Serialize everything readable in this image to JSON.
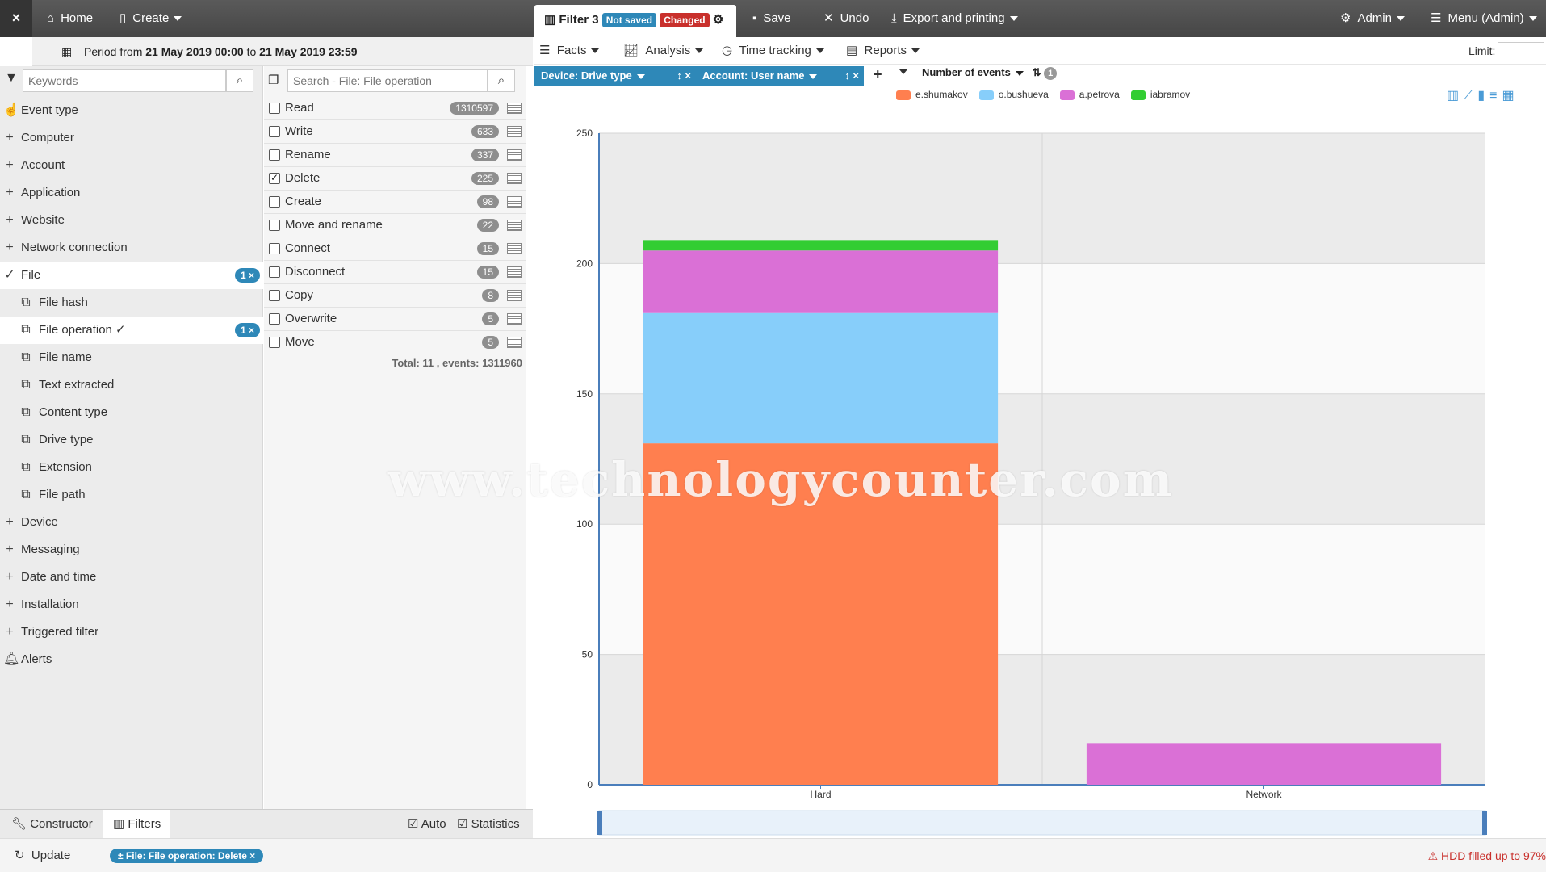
{
  "topbar": {
    "close_label": "×",
    "home": "Home",
    "create": "Create",
    "filter_title": "Filter 3",
    "not_saved": "Not saved",
    "changed": "Changed",
    "save": "Save",
    "undo": "Undo",
    "export": "Export and printing",
    "admin": "Admin",
    "menu": "Menu (Admin)"
  },
  "period": {
    "prefix": "Period from",
    "from": "21 May 2019 00:00",
    "to_word": "to",
    "to": "21 May 2019 23:59"
  },
  "sidebar": {
    "keywords_placeholder": "Keywords",
    "items": [
      {
        "label": "Event type",
        "kind": "icon",
        "icon": "hand-icon"
      },
      {
        "label": "Computer",
        "kind": "plus"
      },
      {
        "label": "Account",
        "kind": "plus"
      },
      {
        "label": "Application",
        "kind": "plus"
      },
      {
        "label": "Website",
        "kind": "plus"
      },
      {
        "label": "Network connection",
        "kind": "plus"
      },
      {
        "label": "File",
        "kind": "check",
        "count": "1 ×"
      },
      {
        "label": "File hash",
        "kind": "sub"
      },
      {
        "label": "File operation ✓",
        "kind": "sub",
        "count": "1 ×"
      },
      {
        "label": "File name",
        "kind": "sub"
      },
      {
        "label": "Text extracted",
        "kind": "sub"
      },
      {
        "label": "Content type",
        "kind": "sub"
      },
      {
        "label": "Drive type",
        "kind": "sub"
      },
      {
        "label": "Extension",
        "kind": "sub"
      },
      {
        "label": "File path",
        "kind": "sub"
      },
      {
        "label": "Device",
        "kind": "plus"
      },
      {
        "label": "Messaging",
        "kind": "plus"
      },
      {
        "label": "Date and time",
        "kind": "plus"
      },
      {
        "label": "Installation",
        "kind": "plus"
      },
      {
        "label": "Triggered filter",
        "kind": "plus"
      },
      {
        "label": "Alerts",
        "kind": "icon",
        "icon": "bell-icon"
      }
    ]
  },
  "values": {
    "search_placeholder": "Search - File: File operation",
    "rows": [
      {
        "label": "Read",
        "count": "1310597",
        "checked": false
      },
      {
        "label": "Write",
        "count": "633",
        "checked": false
      },
      {
        "label": "Rename",
        "count": "337",
        "checked": false
      },
      {
        "label": "Delete",
        "count": "225",
        "checked": true
      },
      {
        "label": "Create",
        "count": "98",
        "checked": false
      },
      {
        "label": "Move and rename",
        "count": "22",
        "checked": false
      },
      {
        "label": "Connect",
        "count": "15",
        "checked": false
      },
      {
        "label": "Disconnect",
        "count": "15",
        "checked": false
      },
      {
        "label": "Copy",
        "count": "8",
        "checked": false
      },
      {
        "label": "Overwrite",
        "count": "5",
        "checked": false
      },
      {
        "label": "Move",
        "count": "5",
        "checked": false
      }
    ],
    "total": "Total: 11 , events: 1311960"
  },
  "bottom": {
    "constructor": "Constructor",
    "filters": "Filters",
    "auto": "Auto",
    "statistics": "Statistics",
    "update": "Update",
    "chip": "± File: File operation: Delete ×",
    "hdd": "HDD filled up to 97%"
  },
  "toolbar": {
    "facts": "Facts",
    "analysis": "Analysis",
    "time_tracking": "Time tracking",
    "reports": "Reports",
    "limit": "Limit:"
  },
  "dimensions": {
    "drive": "Device: Drive type",
    "account": "Account: User name",
    "metric": "Number of events",
    "sort_badge": "1"
  },
  "colors": {
    "e.shumakov": "#ff7f4f",
    "o.bushueva": "#87cefa",
    "a.petrova": "#da70d6",
    "iabramov": "#32cd32"
  },
  "watermark": "www.technologycounter.com",
  "chart_data": {
    "type": "bar",
    "stacked": true,
    "categories": [
      "Hard",
      "Network"
    ],
    "series": [
      {
        "name": "e.shumakov",
        "values": [
          131,
          0
        ]
      },
      {
        "name": "o.bushueva",
        "values": [
          50,
          0
        ]
      },
      {
        "name": "a.petrova",
        "values": [
          24,
          16
        ]
      },
      {
        "name": "iabramov",
        "values": [
          4,
          0
        ]
      }
    ],
    "ylim": [
      0,
      250
    ],
    "yticks": [
      "0",
      "50",
      "100",
      "150",
      "200",
      "250"
    ],
    "legend": "top",
    "grid": true
  }
}
